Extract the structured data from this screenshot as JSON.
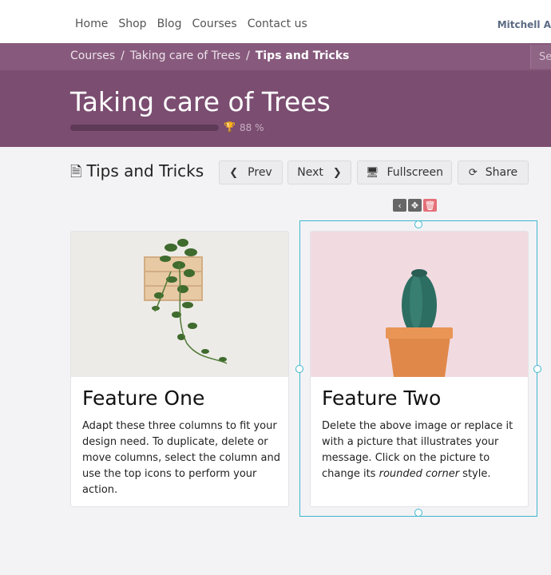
{
  "nav": {
    "items": [
      "Home",
      "Shop",
      "Blog",
      "Courses",
      "Contact us"
    ],
    "user": "Mitchell A"
  },
  "breadcrumb": {
    "items": [
      "Courses",
      "Taking care of Trees",
      "Tips and Tricks"
    ],
    "search_placeholder": "Se"
  },
  "course": {
    "title": "Taking care of Trees",
    "progress_percent": 88,
    "progress_label": "88 %"
  },
  "lesson": {
    "title": "Tips and Tricks",
    "prev_label": "Prev",
    "next_label": "Next",
    "fullscreen_label": "Fullscreen",
    "share_label": "Share"
  },
  "cards": [
    {
      "title": "Feature One",
      "text": "Adapt these three columns to fit your design need. To duplicate, delete or move columns, select the column and use the top icons to perform your action."
    },
    {
      "title": "Feature Two",
      "text_before": "Delete the above image or replace it with a picture that illustrates your message. Click on the picture to change its ",
      "text_em": "rounded corner",
      "text_after": " style."
    }
  ],
  "colors": {
    "hero": "#7b4d71",
    "breadcrumb_bar": "#875a7d",
    "selection": "#3fb6d0",
    "delete": "#e46f78"
  }
}
